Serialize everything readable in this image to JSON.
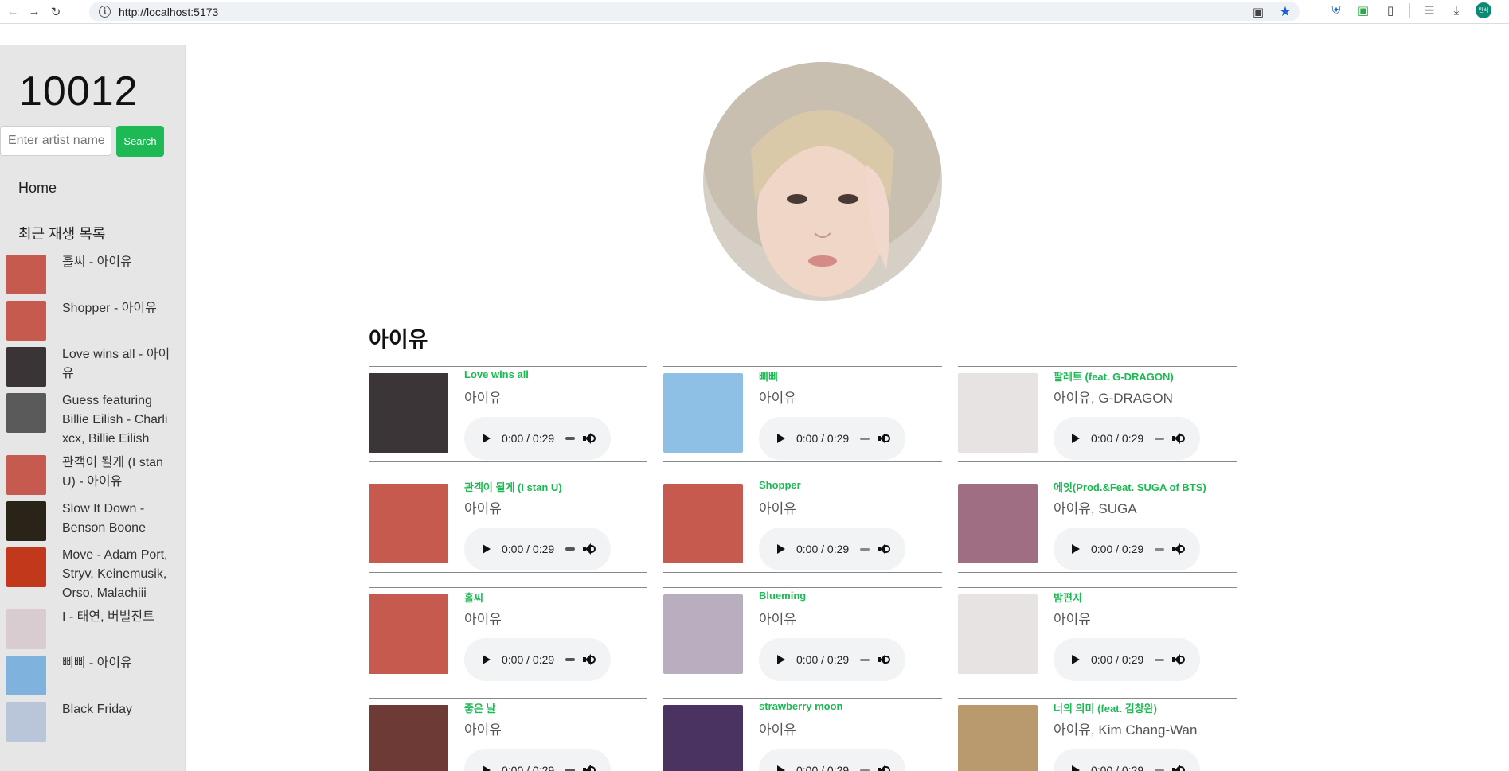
{
  "browser": {
    "url": "http://localhost:5173",
    "profile_label": "민식"
  },
  "sidebar": {
    "logo": "10012",
    "search_placeholder": "Enter artist name",
    "search_button": "Search",
    "home": "Home",
    "recent_heading": "최근 재생 목록",
    "recent": [
      {
        "label": "홀씨 - 아이유",
        "thumb": "#c65a4f"
      },
      {
        "label": "Shopper - 아이유",
        "thumb": "#c65a4f"
      },
      {
        "label": "Love wins all - 아이유",
        "thumb": "#3a3436"
      },
      {
        "label": "Guess featuring Billie Eilish - Charli xcx, Billie Eilish",
        "thumb": "#5a5a5a"
      },
      {
        "label": "관객이 될게 (I stan U) - 아이유",
        "thumb": "#c65a4f"
      },
      {
        "label": "Slow It Down - Benson Boone",
        "thumb": "#2a2418"
      },
      {
        "label": "Move - Adam Port, Stryv, Keinemusik, Orso, Malachiii",
        "thumb": "#c2381a"
      },
      {
        "label": "I - 태연, 버벌진트",
        "thumb": "#d9ccd1"
      },
      {
        "label": "삐삐 - 아이유",
        "thumb": "#7fb3de"
      },
      {
        "label": "Black Friday",
        "thumb": "#b9c6da"
      }
    ]
  },
  "artist": {
    "name": "아이유"
  },
  "tracks": [
    {
      "title": "Love wins all",
      "artist": "아이유",
      "time": "0:00 / 0:29",
      "cover": "#3c3537"
    },
    {
      "title": "삐삐",
      "artist": "아이유",
      "time": "0:00 / 0:29",
      "cover": "#8ec0e6"
    },
    {
      "title": "팔레트 (feat. G-DRAGON)",
      "artist": "아이유, G-DRAGON",
      "time": "0:00 / 0:29",
      "cover": "#e7e3e2"
    },
    {
      "title": "관객이 될게 (I stan U)",
      "artist": "아이유",
      "time": "0:00 / 0:29",
      "cover": "#c65a4f"
    },
    {
      "title": "Shopper",
      "artist": "아이유",
      "time": "0:00 / 0:29",
      "cover": "#c65a4f"
    },
    {
      "title": "에잇(Prod.&Feat. SUGA of BTS)",
      "artist": "아이유, SUGA",
      "time": "0:00 / 0:29",
      "cover": "#9f6e82"
    },
    {
      "title": "홀씨",
      "artist": "아이유",
      "time": "0:00 / 0:29",
      "cover": "#c65a4f"
    },
    {
      "title": "Blueming",
      "artist": "아이유",
      "time": "0:00 / 0:29",
      "cover": "#b8aec0"
    },
    {
      "title": "밤편지",
      "artist": "아이유",
      "time": "0:00 / 0:29",
      "cover": "#e7e3e2"
    },
    {
      "title": "좋은 날",
      "artist": "아이유",
      "time": "0:00 / 0:29",
      "cover": "#6e3a36"
    },
    {
      "title": "strawberry moon",
      "artist": "아이유",
      "time": "0:00 / 0:29",
      "cover": "#4a3360"
    },
    {
      "title": "너의 의미 (feat. 김창완)",
      "artist": "아이유, Kim Chang-Wan",
      "time": "0:00 / 0:29",
      "cover": "#b89a6e"
    }
  ]
}
